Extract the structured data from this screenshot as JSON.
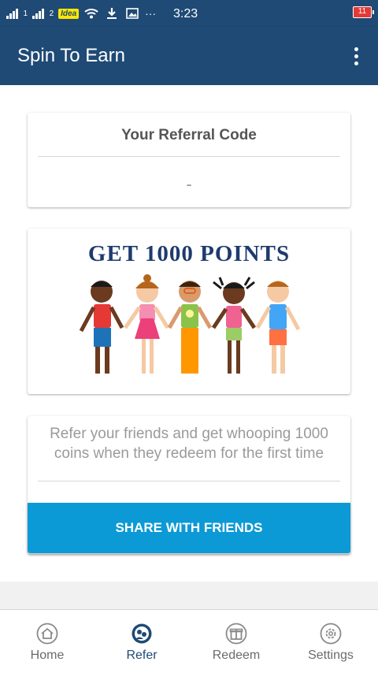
{
  "status_bar": {
    "sim1": "1",
    "sim2": "2",
    "carrier": "Idea",
    "dots": "···",
    "time": "3:23",
    "battery": "11",
    "icons": [
      "signal-icon",
      "signal-icon",
      "wifi-icon",
      "download-icon",
      "image-icon"
    ]
  },
  "app_bar": {
    "title": "Spin To Earn",
    "menu_icon": "more-vert-icon"
  },
  "referral": {
    "title": "Your Referral Code",
    "code": "-"
  },
  "banner": {
    "headline": "GET 1000 POINTS"
  },
  "refer": {
    "text": "Refer your friends and get whooping 1000 coins when they redeem for the first time",
    "button": "SHARE WITH FRIENDS"
  },
  "bottom_nav": {
    "items": [
      {
        "label": "Home",
        "icon": "home-icon"
      },
      {
        "label": "Refer",
        "icon": "refer-icon",
        "active": true
      },
      {
        "label": "Redeem",
        "icon": "gift-icon"
      },
      {
        "label": "Settings",
        "icon": "settings-icon"
      }
    ]
  },
  "colors": {
    "primary": "#1f4a75",
    "accent": "#0c9ad6",
    "battery_low": "#e53935",
    "carrier_badge": "#ffe600"
  }
}
